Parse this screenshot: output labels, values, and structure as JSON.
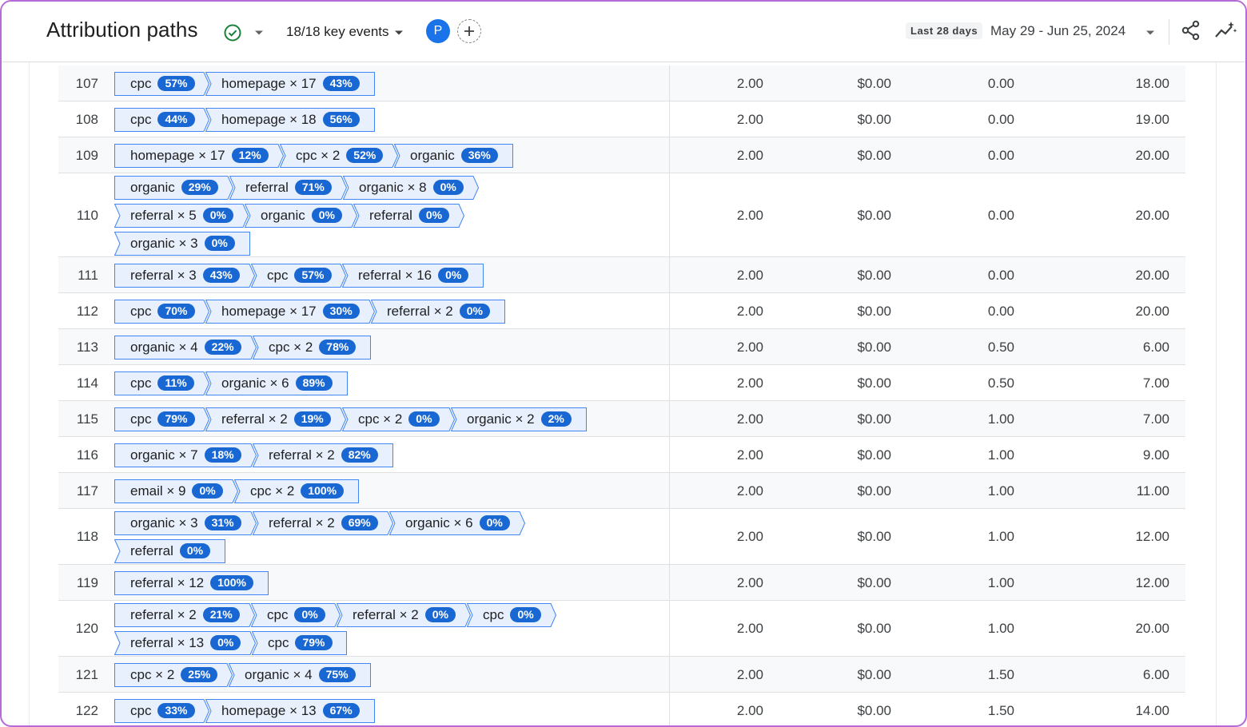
{
  "header": {
    "title": "Attribution paths",
    "key_events": "18/18 key events",
    "avatar_letter": "P",
    "date_chip": "Last 28 days",
    "date_range": "May 29 - Jun 25, 2024"
  },
  "colors": {
    "accent": "#1a73e8",
    "chip_bg": "#e8f0fe",
    "chip_border": "#4285f4",
    "badge": "#1967d2",
    "check": "#188038"
  },
  "rows": [
    {
      "num": "107",
      "lines": [
        [
          [
            "cpc",
            "57%"
          ],
          [
            "homepage × 17",
            "43%"
          ]
        ]
      ],
      "v": [
        "2.00",
        "$0.00",
        "0.00",
        "18.00"
      ]
    },
    {
      "num": "108",
      "lines": [
        [
          [
            "cpc",
            "44%"
          ],
          [
            "homepage × 18",
            "56%"
          ]
        ]
      ],
      "v": [
        "2.00",
        "$0.00",
        "0.00",
        "19.00"
      ]
    },
    {
      "num": "109",
      "lines": [
        [
          [
            "homepage × 17",
            "12%"
          ],
          [
            "cpc × 2",
            "52%"
          ],
          [
            "organic",
            "36%"
          ]
        ]
      ],
      "v": [
        "2.00",
        "$0.00",
        "0.00",
        "20.00"
      ]
    },
    {
      "num": "110",
      "lines": [
        [
          [
            "organic",
            "29%"
          ],
          [
            "referral",
            "71%"
          ],
          [
            "organic × 8",
            "0%"
          ]
        ],
        [
          [
            "referral × 5",
            "0%"
          ],
          [
            "organic",
            "0%"
          ],
          [
            "referral",
            "0%"
          ]
        ],
        [
          [
            "organic × 3",
            "0%"
          ]
        ]
      ],
      "v": [
        "2.00",
        "$0.00",
        "0.00",
        "20.00"
      ]
    },
    {
      "num": "111",
      "lines": [
        [
          [
            "referral × 3",
            "43%"
          ],
          [
            "cpc",
            "57%"
          ],
          [
            "referral × 16",
            "0%"
          ]
        ]
      ],
      "v": [
        "2.00",
        "$0.00",
        "0.00",
        "20.00"
      ]
    },
    {
      "num": "112",
      "lines": [
        [
          [
            "cpc",
            "70%"
          ],
          [
            "homepage × 17",
            "30%"
          ],
          [
            "referral × 2",
            "0%"
          ]
        ]
      ],
      "v": [
        "2.00",
        "$0.00",
        "0.00",
        "20.00"
      ]
    },
    {
      "num": "113",
      "lines": [
        [
          [
            "organic × 4",
            "22%"
          ],
          [
            "cpc × 2",
            "78%"
          ]
        ]
      ],
      "v": [
        "2.00",
        "$0.00",
        "0.50",
        "6.00"
      ]
    },
    {
      "num": "114",
      "lines": [
        [
          [
            "cpc",
            "11%"
          ],
          [
            "organic × 6",
            "89%"
          ]
        ]
      ],
      "v": [
        "2.00",
        "$0.00",
        "0.50",
        "7.00"
      ]
    },
    {
      "num": "115",
      "lines": [
        [
          [
            "cpc",
            "79%"
          ],
          [
            "referral × 2",
            "19%"
          ],
          [
            "cpc × 2",
            "0%"
          ],
          [
            "organic × 2",
            "2%"
          ]
        ]
      ],
      "v": [
        "2.00",
        "$0.00",
        "1.00",
        "7.00"
      ]
    },
    {
      "num": "116",
      "lines": [
        [
          [
            "organic × 7",
            "18%"
          ],
          [
            "referral × 2",
            "82%"
          ]
        ]
      ],
      "v": [
        "2.00",
        "$0.00",
        "1.00",
        "9.00"
      ]
    },
    {
      "num": "117",
      "lines": [
        [
          [
            "email × 9",
            "0%"
          ],
          [
            "cpc × 2",
            "100%"
          ]
        ]
      ],
      "v": [
        "2.00",
        "$0.00",
        "1.00",
        "11.00"
      ]
    },
    {
      "num": "118",
      "lines": [
        [
          [
            "organic × 3",
            "31%"
          ],
          [
            "referral × 2",
            "69%"
          ],
          [
            "organic × 6",
            "0%"
          ]
        ],
        [
          [
            "referral",
            "0%"
          ]
        ]
      ],
      "v": [
        "2.00",
        "$0.00",
        "1.00",
        "12.00"
      ]
    },
    {
      "num": "119",
      "lines": [
        [
          [
            "referral × 12",
            "100%"
          ]
        ]
      ],
      "v": [
        "2.00",
        "$0.00",
        "1.00",
        "12.00"
      ]
    },
    {
      "num": "120",
      "lines": [
        [
          [
            "referral × 2",
            "21%"
          ],
          [
            "cpc",
            "0%"
          ],
          [
            "referral × 2",
            "0%"
          ],
          [
            "cpc",
            "0%"
          ]
        ],
        [
          [
            "referral × 13",
            "0%"
          ],
          [
            "cpc",
            "79%"
          ]
        ]
      ],
      "v": [
        "2.00",
        "$0.00",
        "1.00",
        "20.00"
      ]
    },
    {
      "num": "121",
      "lines": [
        [
          [
            "cpc × 2",
            "25%"
          ],
          [
            "organic × 4",
            "75%"
          ]
        ]
      ],
      "v": [
        "2.00",
        "$0.00",
        "1.50",
        "6.00"
      ]
    },
    {
      "num": "122",
      "lines": [
        [
          [
            "cpc",
            "33%"
          ],
          [
            "homepage × 13",
            "67%"
          ]
        ]
      ],
      "v": [
        "2.00",
        "$0.00",
        "1.50",
        "14.00"
      ]
    }
  ]
}
